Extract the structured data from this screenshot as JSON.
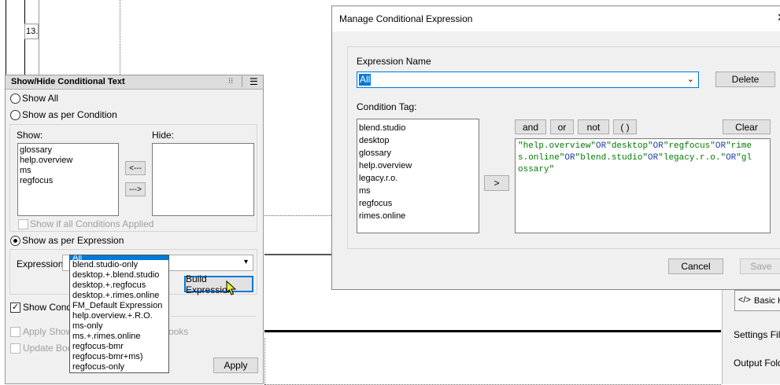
{
  "background_doc": {
    "line_number": "13.",
    "right_panel": {
      "tab_label": "Basic H",
      "tab_icon": "code-icon",
      "settings_file_label": "Settings File:",
      "output_folder_label": "Output Folde"
    }
  },
  "showhide": {
    "title": "Show/Hide Conditional Text",
    "show_all_label": "Show All",
    "show_per_condition_label": "Show as per Condition",
    "show_list_label": "Show:",
    "hide_list_label": "Hide:",
    "show_items": [
      "glossary",
      "help.overview",
      "ms",
      "regfocus"
    ],
    "hide_items": [],
    "move_left_label": "<---",
    "move_right_label": "--->",
    "show_if_all_label": "Show if all Conditions Applied",
    "show_per_expression_label": "Show as per Expression",
    "expression_label": "Expression:",
    "build_expression_label": "Build Expression",
    "show_cond_label": "Show Cond",
    "apply_show_label": "Apply Show",
    "books_fragment": "ooks",
    "update_book_label": "Update Boo",
    "apply_label": "Apply",
    "expression_options": [
      "All",
      "blend.studio-only",
      "desktop.+.blend.studio",
      "desktop.+.regfocus",
      "desktop.+.rimes.online",
      "FM_Default Expression",
      "help.overview.+.R.O.",
      "ms-only",
      "ms.+.rimes.online",
      "regfocus-bmr",
      "regfocus-bmr+ms)",
      "regfocus-only"
    ],
    "selected_option": "All"
  },
  "manage": {
    "title": "Manage Conditional Expression",
    "expression_name_label": "Expression Name",
    "expression_name_value": "All",
    "delete_label": "Delete",
    "condition_tag_label": "Condition Tag:",
    "condition_tags": [
      "blend.studio",
      "desktop",
      "glossary",
      "help.overview",
      "legacy.r.o.",
      "ms",
      "regfocus",
      "rimes.online"
    ],
    "add_label": ">",
    "op_and": "and",
    "op_or": "or",
    "op_not": "not",
    "op_paren": "( )",
    "clear_label": "Clear",
    "expression_text": "\"help.overview\"OR\"desktop\"OR\"regfocus\"OR\"rimes.online\"OR\"blend.studio\"OR\"legacy.r.o.\"OR\"glossary\"",
    "expression_lines": [
      "\"help.overview\"OR\"desktop\"OR\"regfocus\"OR\"rime",
      "s.online\"OR\"blend.studio\"OR\"legacy.r.o.\"OR\"gl",
      "ossary\""
    ],
    "cancel_label": "Cancel",
    "save_label": "Save"
  },
  "colors": {
    "accent": "#0078d7",
    "string_green": "#007a00",
    "keyword_blue": "#1f3fa8"
  }
}
